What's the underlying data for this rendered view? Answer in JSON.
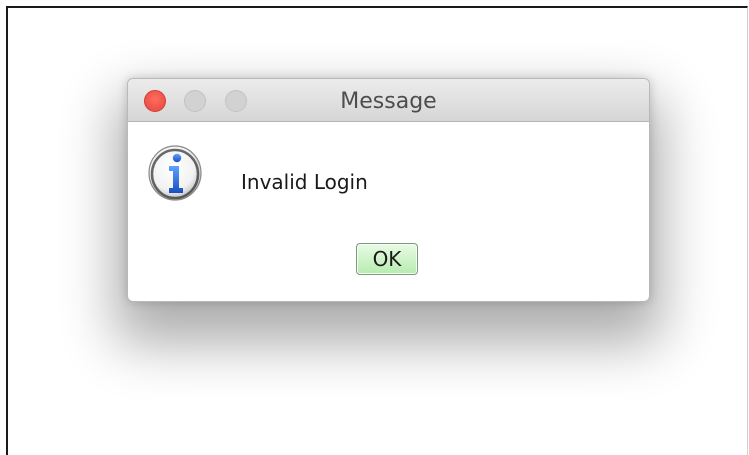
{
  "dialog": {
    "title": "Message",
    "message": "Invalid Login",
    "ok_label": "OK",
    "icon": "info-icon"
  },
  "colors": {
    "close_light": "#ff5f57",
    "inactive_light": "#d2d2d2",
    "ok_button": "#b7ebb0",
    "info_blue": "#2a66d8"
  }
}
